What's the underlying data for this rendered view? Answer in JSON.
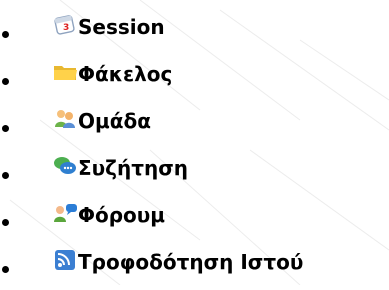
{
  "menu": {
    "items": [
      {
        "label": "Session",
        "icon": "calendar-icon"
      },
      {
        "label": "Φάκελος",
        "icon": "folder-icon"
      },
      {
        "label": "Ομάδα",
        "icon": "users-group-icon"
      },
      {
        "label": "Συζήτηση",
        "icon": "chat-bubbles-icon"
      },
      {
        "label": "Φόρουμ",
        "icon": "forum-users-icon"
      },
      {
        "label": "Τροφοδότηση Ιστού",
        "icon": "rss-feed-icon"
      }
    ]
  }
}
